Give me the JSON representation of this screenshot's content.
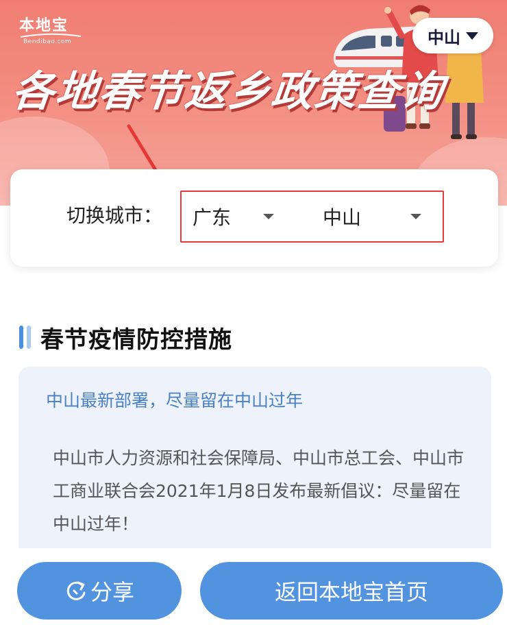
{
  "logo": {
    "brand_text": "本地宝",
    "brand_sub": "Bendibao.com"
  },
  "header": {
    "city_selector": {
      "value": "中山",
      "icon": "caret-down-icon"
    },
    "banner_title": "各地春节返乡政策查询"
  },
  "switch_city": {
    "label": "切换城市：",
    "province": {
      "value": "广东",
      "icon": "dropdown-caret-icon"
    },
    "city": {
      "value": "中山",
      "icon": "dropdown-caret-icon"
    },
    "highlight_color": "#e53935"
  },
  "section": {
    "title": "春节疫情防控措施",
    "card": {
      "headline": "中山最新部署，尽量留在中山过年",
      "body": "中山市人力资源和社会保障局、中山市总工会、中山市工商业联合会2021年1月8日发布最新倡议：尽量留在中山过年！"
    }
  },
  "bottom": {
    "share_label": "分享",
    "share_icon": "share-refresh-icon",
    "home_label": "返回本地宝首页"
  },
  "colors": {
    "banner": "#f07d72",
    "accent_blue": "#5293e0",
    "headline_blue": "#4a7fc1",
    "card_bg": "#eef3fb",
    "annotation_red": "#e53935"
  }
}
